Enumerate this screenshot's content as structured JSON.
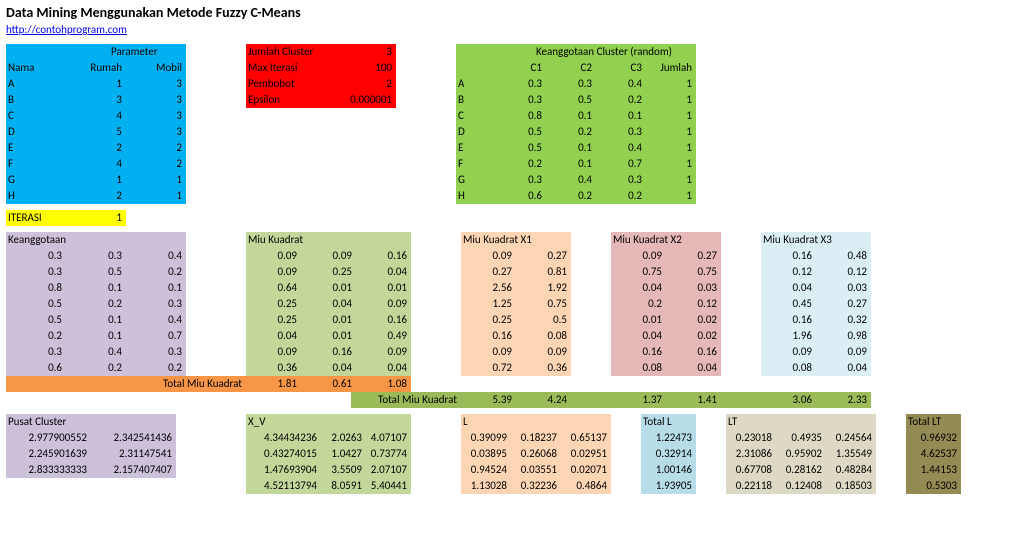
{
  "title": "Data Mining Menggunakan Metode Fuzzy C-Means",
  "url": "http://contohprogram.com",
  "paramHeader": "Parameter",
  "paramCols": [
    "Nama",
    "Rumah",
    "Mobil"
  ],
  "paramRows": [
    {
      "n": "A",
      "r": 1,
      "m": 3
    },
    {
      "n": "B",
      "r": 3,
      "m": 3
    },
    {
      "n": "C",
      "r": 4,
      "m": 3
    },
    {
      "n": "D",
      "r": 5,
      "m": 3
    },
    {
      "n": "E",
      "r": 2,
      "m": 2
    },
    {
      "n": "F",
      "r": 4,
      "m": 2
    },
    {
      "n": "G",
      "r": 1,
      "m": 1
    },
    {
      "n": "H",
      "r": 2,
      "m": 1
    }
  ],
  "cfg": [
    {
      "k": "Jumlah Cluster",
      "v": "3"
    },
    {
      "k": "Max Iterasi",
      "v": "100"
    },
    {
      "k": "Pembobot",
      "v": "2"
    },
    {
      "k": "Epsilon",
      "v": "0.000001"
    }
  ],
  "membHeader": "Keanggotaan Cluster (random)",
  "membCols": [
    "C1",
    "C2",
    "C3",
    "Jumlah"
  ],
  "membLabels": [
    "A",
    "B",
    "C",
    "D",
    "E",
    "F",
    "G",
    "H"
  ],
  "membRows": [
    [
      "0.3",
      "0.3",
      "0.4",
      "1"
    ],
    [
      "0.3",
      "0.5",
      "0.2",
      "1"
    ],
    [
      "0.8",
      "0.1",
      "0.1",
      "1"
    ],
    [
      "0.5",
      "0.2",
      "0.3",
      "1"
    ],
    [
      "0.5",
      "0.1",
      "0.4",
      "1"
    ],
    [
      "0.2",
      "0.1",
      "0.7",
      "1"
    ],
    [
      "0.3",
      "0.4",
      "0.3",
      "1"
    ],
    [
      "0.6",
      "0.2",
      "0.2",
      "1"
    ]
  ],
  "iterLabel": "ITERASI",
  "iterVal": "1",
  "keangLabel": "Keanggotaan",
  "keangRows": [
    [
      "0.3",
      "0.3",
      "0.4"
    ],
    [
      "0.3",
      "0.5",
      "0.2"
    ],
    [
      "0.8",
      "0.1",
      "0.1"
    ],
    [
      "0.5",
      "0.2",
      "0.3"
    ],
    [
      "0.5",
      "0.1",
      "0.4"
    ],
    [
      "0.2",
      "0.1",
      "0.7"
    ],
    [
      "0.3",
      "0.4",
      "0.3"
    ],
    [
      "0.6",
      "0.2",
      "0.2"
    ]
  ],
  "miuKLabel": "Miu Kuadrat",
  "miuKRows": [
    [
      "0.09",
      "0.09",
      "0.16"
    ],
    [
      "0.09",
      "0.25",
      "0.04"
    ],
    [
      "0.64",
      "0.01",
      "0.01"
    ],
    [
      "0.25",
      "0.04",
      "0.09"
    ],
    [
      "0.25",
      "0.01",
      "0.16"
    ],
    [
      "0.04",
      "0.01",
      "0.49"
    ],
    [
      "0.09",
      "0.16",
      "0.09"
    ],
    [
      "0.36",
      "0.04",
      "0.04"
    ]
  ],
  "totMiuKLabel": "Total Miu Kuadrat",
  "totMiuK": [
    "1.81",
    "0.61",
    "1.08"
  ],
  "mX1Label": "Miu Kuadrat X1",
  "mX1Rows": [
    [
      "0.09",
      "0.27"
    ],
    [
      "0.27",
      "0.81"
    ],
    [
      "2.56",
      "1.92"
    ],
    [
      "1.25",
      "0.75"
    ],
    [
      "0.25",
      "0.5"
    ],
    [
      "0.16",
      "0.08"
    ],
    [
      "0.09",
      "0.09"
    ],
    [
      "0.72",
      "0.36"
    ]
  ],
  "totMKLabel": "Total Miu Kuadrat",
  "totMX1": [
    "5.39",
    "4.24"
  ],
  "mX2Label": "Miu Kuadrat X2",
  "mX2Rows": [
    [
      "0.09",
      "0.27"
    ],
    [
      "0.75",
      "0.75"
    ],
    [
      "0.04",
      "0.03"
    ],
    [
      "0.2",
      "0.12"
    ],
    [
      "0.01",
      "0.02"
    ],
    [
      "0.04",
      "0.02"
    ],
    [
      "0.16",
      "0.16"
    ],
    [
      "0.08",
      "0.04"
    ]
  ],
  "totMX2": [
    "1.37",
    "1.41"
  ],
  "mX3Label": "Miu Kuadrat X3",
  "mX3Rows": [
    [
      "0.16",
      "0.48"
    ],
    [
      "0.12",
      "0.12"
    ],
    [
      "0.04",
      "0.03"
    ],
    [
      "0.45",
      "0.27"
    ],
    [
      "0.16",
      "0.32"
    ],
    [
      "1.96",
      "0.98"
    ],
    [
      "0.09",
      "0.09"
    ],
    [
      "0.08",
      "0.04"
    ]
  ],
  "totMX3": [
    "3.06",
    "2.33"
  ],
  "pcLabel": "Pusat Cluster",
  "pcRows": [
    [
      "2.977900552",
      "2.342541436"
    ],
    [
      "2.245901639",
      "2.31147541"
    ],
    [
      "2.833333333",
      "2.157407407"
    ]
  ],
  "xvLabel": "X_V",
  "xvRows": [
    [
      "4.34434236",
      "2.0263",
      "4.07107"
    ],
    [
      "0.43274015",
      "1.0427",
      "0.73774"
    ],
    [
      "1.47693904",
      "3.5509",
      "2.07107"
    ],
    [
      "4.52113794",
      "8.0591",
      "5.40441"
    ]
  ],
  "lLabel": "L",
  "lRows": [
    [
      "0.39099",
      "0.18237",
      "0.65137"
    ],
    [
      "0.03895",
      "0.26068",
      "0.02951"
    ],
    [
      "0.94524",
      "0.03551",
      "0.02071"
    ],
    [
      "1.13028",
      "0.32236",
      "0.4864"
    ]
  ],
  "tlLabel": "Total L",
  "tlRows": [
    "1.22473",
    "0.32914",
    "1.00146",
    "1.93905"
  ],
  "ltLabel": "LT",
  "ltRows": [
    [
      "0.23018",
      "0.4935",
      "0.24564"
    ],
    [
      "2.31086",
      "0.95902",
      "1.35549"
    ],
    [
      "0.67708",
      "0.28162",
      "0.48284"
    ],
    [
      "0.22118",
      "0.12408",
      "0.18503"
    ]
  ],
  "tltLabel": "Total LT",
  "tltRows": [
    "0.96932",
    "4.62537",
    "1.44153",
    "0.5303"
  ]
}
